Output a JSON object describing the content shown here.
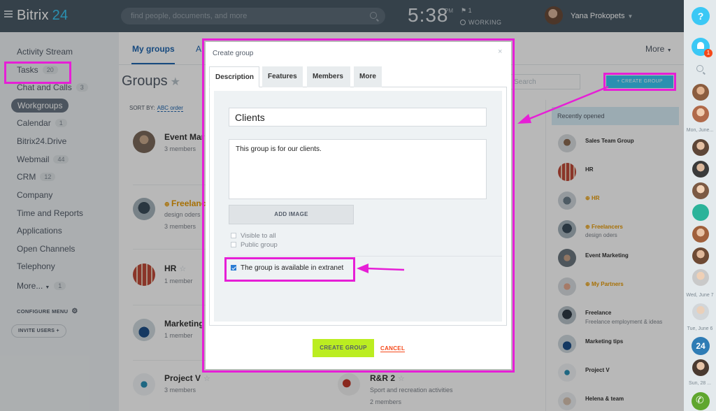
{
  "header": {
    "logo_name": "Bitrix",
    "logo_num": "24",
    "search_placeholder": "find people, documents, and more",
    "clock": "5:38",
    "ampm": "PM",
    "flag_count": "1",
    "status": "WORKING",
    "user_name": "Yana Prokopets"
  },
  "sidebar": {
    "items": [
      {
        "label": "Activity Stream",
        "count": ""
      },
      {
        "label": "Tasks",
        "count": "20"
      },
      {
        "label": "Chat and Calls",
        "count": "3"
      },
      {
        "label": "Workgroups",
        "count": ""
      },
      {
        "label": "Calendar",
        "count": "1"
      },
      {
        "label": "Bitrix24.Drive",
        "count": ""
      },
      {
        "label": "Webmail",
        "count": "44"
      },
      {
        "label": "CRM",
        "count": "12"
      },
      {
        "label": "Company",
        "count": ""
      },
      {
        "label": "Time and Reports",
        "count": ""
      },
      {
        "label": "Applications",
        "count": ""
      },
      {
        "label": "Open Channels",
        "count": ""
      },
      {
        "label": "Telephony",
        "count": ""
      },
      {
        "label": "More...",
        "count": "1"
      }
    ],
    "configure_menu": "CONFIGURE MENU",
    "invite_users": "INVITE USERS"
  },
  "main": {
    "tabs": [
      {
        "label": "My groups"
      },
      {
        "label": "A"
      }
    ],
    "more": "More",
    "title": "Groups",
    "sort_label": "SORT BY:",
    "sort_value": "ABC order",
    "search_placeholder": "Search",
    "create_group": "CREATE GROUP",
    "groups": [
      {
        "name": "Event Mar",
        "sub": "3 members"
      },
      {
        "name": "Freelanc",
        "sub1": "design oders",
        "sub2": "3 members"
      },
      {
        "name": "HR",
        "sub": "1 member"
      },
      {
        "name": "Marketing",
        "sub": "1 member"
      },
      {
        "name": "Project V",
        "sub": "3 members"
      },
      {
        "name": "R&R 2",
        "sub1": "Sport and recreation activities",
        "sub2": "2 members"
      }
    ]
  },
  "recent": {
    "title": "Recently opened",
    "items": [
      {
        "name": "Sales Team Group",
        "sub": ""
      },
      {
        "name": "HR",
        "sub": ""
      },
      {
        "name": "HR",
        "sub": ""
      },
      {
        "name": "Freelancers",
        "sub": "design oders"
      },
      {
        "name": "Event Marketing",
        "sub": ""
      },
      {
        "name": "My Partners",
        "sub": ""
      },
      {
        "name": "Freelance",
        "sub": "Freelance employment & ideas"
      },
      {
        "name": "Marketing tips",
        "sub": ""
      },
      {
        "name": "Project V",
        "sub": ""
      },
      {
        "name": "Helena & team",
        "sub": ""
      }
    ]
  },
  "rail": {
    "help": "?",
    "notifications": "1",
    "labels": [
      "Mon, June...",
      "Wed, June 7",
      "Tue, June 6",
      "Sun, 28 ..."
    ],
    "badge_24": "24"
  },
  "dialog": {
    "title": "Create group",
    "close": "×",
    "tabs": [
      {
        "label": "Description"
      },
      {
        "label": "Features"
      },
      {
        "label": "Members"
      },
      {
        "label": "More"
      }
    ],
    "name_value": "Clients",
    "description_value": "This group is for our clients.",
    "add_image": "ADD IMAGE",
    "visible_to_all": "Visible to all",
    "public_group": "Public group",
    "extranet": "The group is available in extranet",
    "create_button": "CREATE GROUP",
    "cancel_button": "CANCEL"
  },
  "colors": {
    "accent": "#3bc8f5",
    "highlight": "#e61fd6",
    "create_green": "#bbed21",
    "cancel_red": "#f54819"
  }
}
